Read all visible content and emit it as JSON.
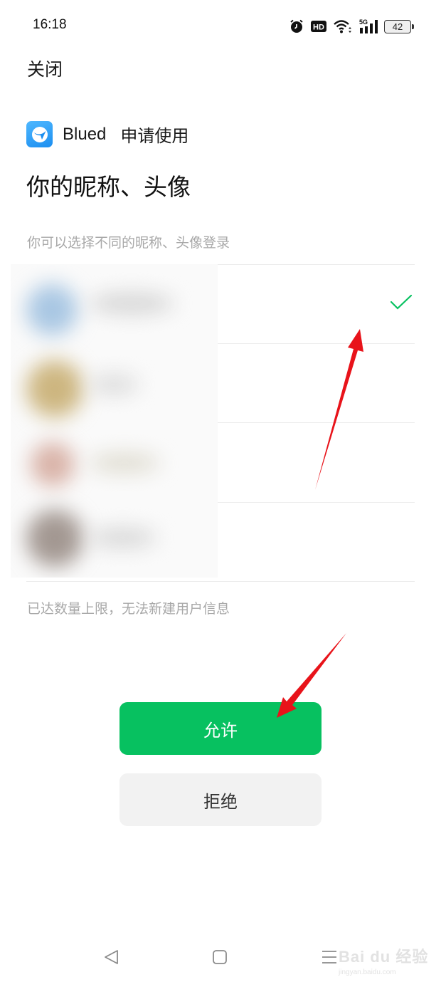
{
  "status_bar": {
    "time": "16:18",
    "icons": [
      "alarm-icon",
      "hd-icon",
      "wifi-icon",
      "signal-5g-icon"
    ],
    "network_label": "5G",
    "hd_label": "HD",
    "battery": "42"
  },
  "header": {
    "close_label": "关闭"
  },
  "app": {
    "name": "Blued",
    "request_text": "申请使用",
    "icon": "blued-logo-icon",
    "brand_color": "#1b8ef0"
  },
  "permission": {
    "title": "你的昵称、头像",
    "hint": "你可以选择不同的昵称、头像登录",
    "limit_hint": "已达数量上限，无法新建用户信息"
  },
  "accounts": [
    {
      "name": "",
      "selected": true,
      "avatar_color": "#a9c7e3"
    },
    {
      "name": "",
      "selected": false,
      "avatar_color": "#cdb680"
    },
    {
      "name": "",
      "selected": false,
      "avatar_color": "#d9b3a8"
    },
    {
      "name": "",
      "selected": false,
      "avatar_color": "#a39892"
    }
  ],
  "buttons": {
    "allow_label": "允许",
    "deny_label": "拒绝",
    "allow_color": "#07c160",
    "deny_color": "#f2f2f2"
  },
  "nav_bar": {
    "back": "back-triangle-icon",
    "home": "home-square-icon",
    "menu": "menu-lines-icon"
  },
  "watermark": {
    "main": "Bai du 经验",
    "sub": "jingyan.baidu.com"
  }
}
